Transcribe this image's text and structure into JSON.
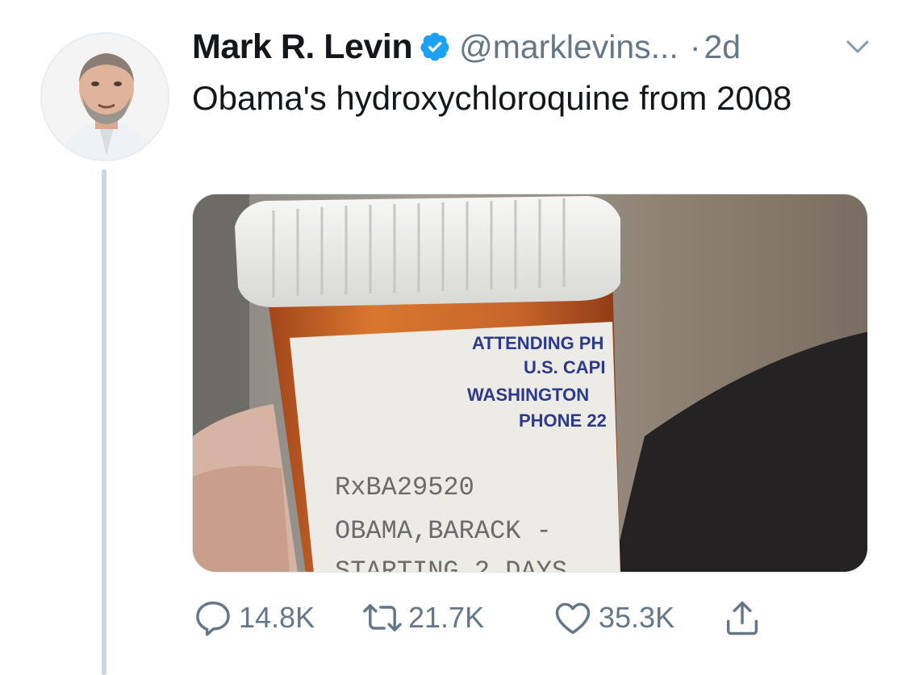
{
  "tweet": {
    "author_name": "Mark R. Levin",
    "handle": "@marklevins...",
    "separator": "·",
    "time": "2d",
    "text": "Obama's hydroxychloroquine from 2008",
    "verified": true
  },
  "photo_label": {
    "lines": [
      "ATTENDING PH",
      "U.S. CAPI",
      "WASHINGTON",
      "PHONE 22"
    ],
    "rx": "RxBA29520",
    "patient": "OBAMA,BARACK - ",
    "partial": "STARTING 2 DAYS"
  },
  "actions": {
    "reply_count": "14.8K",
    "retweet_count": "21.7K",
    "like_count": "35.3K"
  },
  "colors": {
    "text_primary": "#14171a",
    "text_secondary": "#657786",
    "verified_blue": "#1da1f2",
    "thread_line": "#ccd6dd"
  },
  "icons": [
    "verified-badge-icon",
    "chevron-down-icon",
    "reply-icon",
    "retweet-icon",
    "heart-icon",
    "share-icon"
  ]
}
